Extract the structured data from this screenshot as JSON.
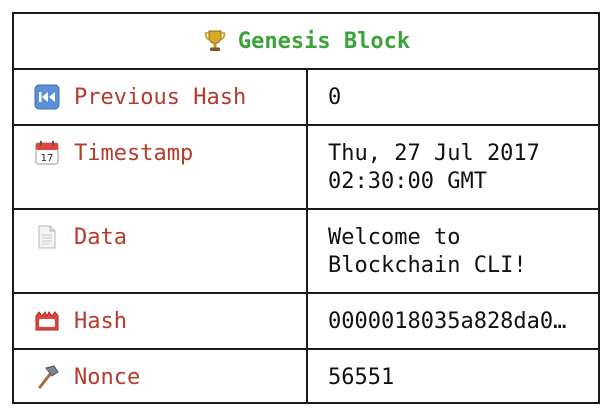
{
  "block": {
    "title": "Genesis Block",
    "title_icon": "trophy-icon"
  },
  "rows": [
    {
      "label": "Previous Hash",
      "icon": "rewind-icon",
      "value": "0"
    },
    {
      "label": "Timestamp",
      "icon": "calendar-icon",
      "value": "Thu, 27 Jul 2017\n02:30:00 GMT"
    },
    {
      "label": "Data",
      "icon": "document-icon",
      "value": "Welcome to\nBlockchain CLI!"
    },
    {
      "label": "Hash",
      "icon": "name-badge-icon",
      "value": "0000018035a828da0…"
    },
    {
      "label": "Nonce",
      "icon": "hammer-icon",
      "value": "56551"
    }
  ],
  "colors": {
    "title": "#3aa33a",
    "label": "#b83a2c",
    "border": "#1a1a1a"
  }
}
